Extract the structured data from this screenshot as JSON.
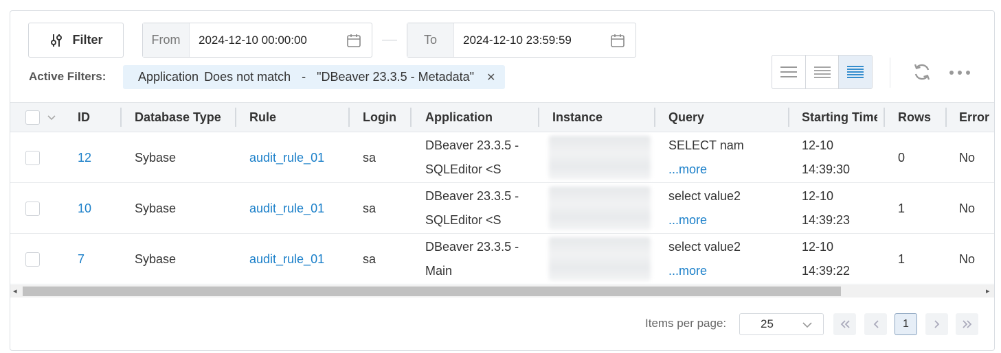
{
  "toolbar": {
    "filter_label": "Filter",
    "from_label": "From",
    "from_value": "2024-12-10 00:00:00",
    "to_label": "To",
    "to_value": "2024-12-10 23:59:59"
  },
  "active_filters": {
    "label": "Active Filters:",
    "chips": [
      {
        "field": "Application",
        "operator": "Does not match",
        "separator": "-",
        "value": "\"DBeaver 23.3.5 - Metadata\""
      }
    ]
  },
  "table": {
    "columns": [
      "ID",
      "Database Type",
      "Rule",
      "Login",
      "Application",
      "Instance",
      "Query",
      "Starting Time",
      "Rows",
      "Error"
    ],
    "more_link": "...more",
    "rows": [
      {
        "id": "12",
        "db_type": "Sybase",
        "rule": "audit_rule_01",
        "login": "sa",
        "app_line1": "DBeaver 23.3.5 -",
        "app_line2": "SQLEditor <S",
        "query": "SELECT nam",
        "date": "12-10",
        "time": "14:39:30",
        "rows": "0",
        "error": "No"
      },
      {
        "id": "10",
        "db_type": "Sybase",
        "rule": "audit_rule_01",
        "login": "sa",
        "app_line1": "DBeaver 23.3.5 -",
        "app_line2": "SQLEditor <S",
        "query": "select value2",
        "date": "12-10",
        "time": "14:39:23",
        "rows": "1",
        "error": "No"
      },
      {
        "id": "7",
        "db_type": "Sybase",
        "rule": "audit_rule_01",
        "login": "sa",
        "app_line1": "DBeaver 23.3.5 -",
        "app_line2": "Main",
        "query": "select value2",
        "date": "12-10",
        "time": "14:39:22",
        "rows": "1",
        "error": "No"
      }
    ]
  },
  "pagination": {
    "items_per_page_label": "Items per page:",
    "items_per_page": "25",
    "current_page": "1"
  },
  "icons": {
    "filter": "sliders-icon",
    "calendar": "calendar-icon",
    "close": "close-icon",
    "density": [
      "density-loose-icon",
      "density-normal-icon",
      "density-compact-icon"
    ],
    "refresh": "refresh-icon",
    "more": "more-horizontal-icon"
  },
  "colors": {
    "link": "#1a7fc9",
    "chip_bg": "#e7f2fb",
    "header_bg": "#f3f5f7"
  }
}
